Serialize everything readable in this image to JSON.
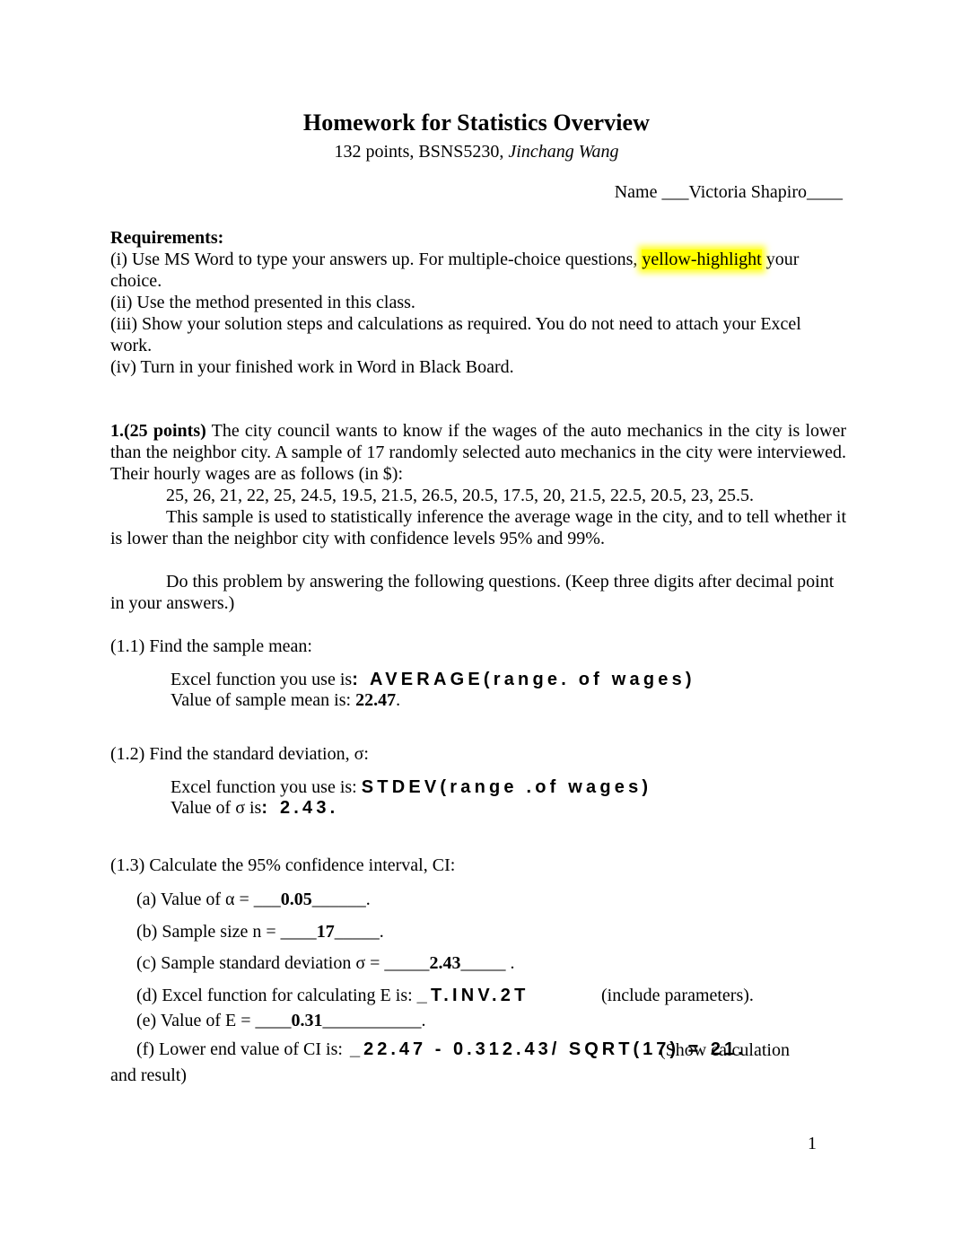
{
  "document": {
    "title": "Homework for Statistics Overview",
    "subtitle_points": "132 points, BSNS5230, ",
    "subtitle_author": "Jinchang Wang",
    "name_line": "Name ___Victoria Shapiro____",
    "page_number": "1"
  },
  "requirements": {
    "heading": "Requirements:",
    "line_i_a": "(i) Use MS Word to type your answers up.  For multiple-choice questions, ",
    "line_i_highlight": "yellow-highlight",
    "line_i_b": " your choice.",
    "line_ii": "(ii) Use the method presented in this class.",
    "line_iii": "(iii) Show your solution steps and calculations as required. You do not need to attach your Excel work.",
    "line_iv": "(iv) Turn in your finished work in Word in Black Board."
  },
  "question1": {
    "number": "1.",
    "points": "(25 points)",
    "body": " The city council wants to know if the wages of the auto mechanics in the city is lower than the neighbor city.  A sample of 17 randomly selected auto mechanics in the city were interviewed.  Their hourly wages are as follows (in $):",
    "data_values": "25, 26, 21, 22, 25, 24.5, 19.5, 21.5, 26.5, 20.5, 17.5, 20, 21.5, 22.5, 20.5, 23, 25.5.",
    "inference_text": "This sample is used to statistically inference the average wage in the city, and to tell whether it is lower than the neighbor city with confidence levels 95% and 99%.",
    "instructions": "Do this problem by answering the following questions. (Keep three digits after decimal point in your answers.)"
  },
  "part_1_1": {
    "label": "(1.1) Find the sample mean:",
    "excel_prompt": "Excel function you use is",
    "excel_answer": ": AVERAGE(range. of  wages)",
    "value_prompt": "Value of sample mean is: ",
    "value_answer": "22.47",
    "value_period": "."
  },
  "part_1_2": {
    "label": "(1.2) Find the standard deviation, σ:",
    "excel_prompt": "Excel function you use is: ",
    "excel_answer": "STDEV(range .of  wages)",
    "value_prompt": "Value of σ is",
    "value_answer": ": 2.43."
  },
  "part_1_3": {
    "label": "(1.3) Calculate the 95% confidence interval, CI:",
    "item_a_prompt": "(a) Value of α = ___",
    "item_a_answer": "0.05",
    "item_a_tail": "______.",
    "item_b_prompt": "(b) Sample size n = ____",
    "item_b_answer": "17",
    "item_b_tail": "_____.",
    "item_c_prompt": "(c) Sample standard deviation σ = _____",
    "item_c_answer": "2.43",
    "item_c_tail": "_____ .",
    "item_d_prompt": "(d) Excel function for calculating E is: ",
    "item_d_answer": "_T.INV.2T",
    "item_d_overlay": "(include parameters).",
    "item_e_prompt": "(e) Value of E = ____",
    "item_e_answer": "0.31",
    "item_e_tail": "___________.",
    "item_f_prompt": "(f) Lower end value of CI is:",
    "item_f_answer": "_22.47  -  0.312.43/ SQRT(17)   =   21.",
    "item_f_overlay": "(Show calculation",
    "item_f_continuation": "and result)"
  }
}
